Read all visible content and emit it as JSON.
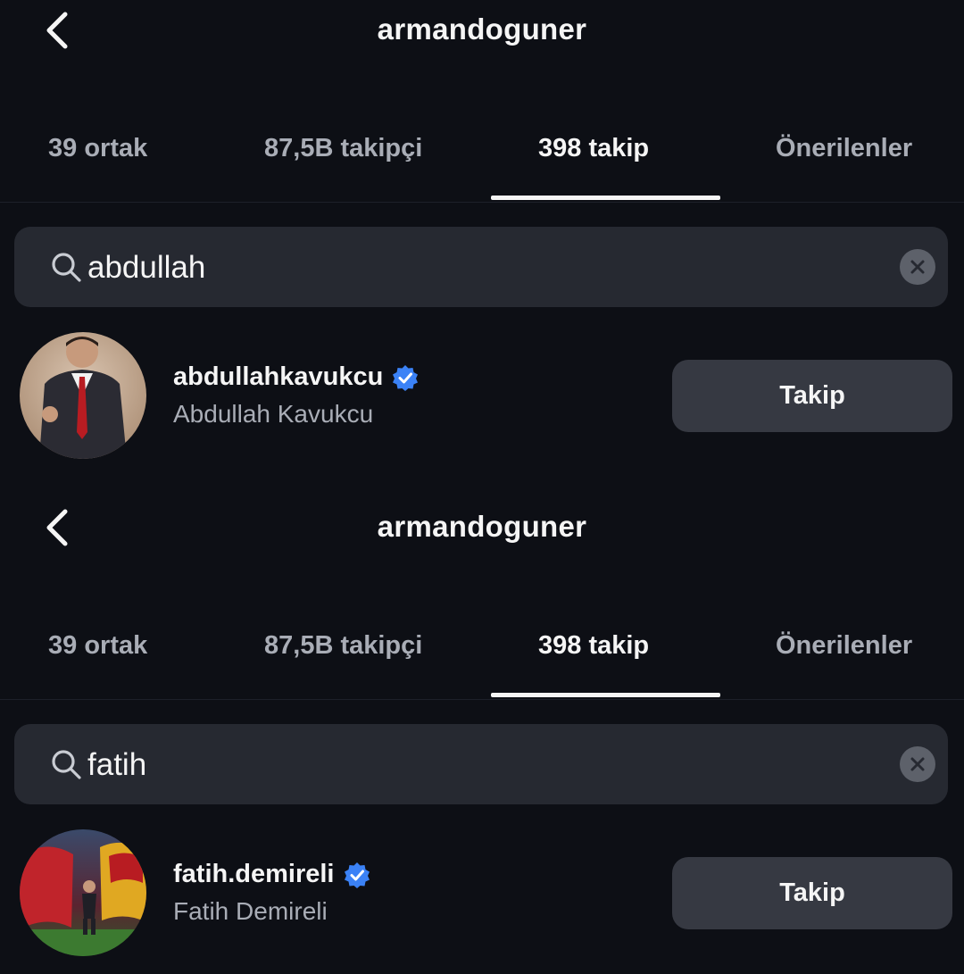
{
  "colors": {
    "background": "#0d0f15",
    "search_bg": "#262931",
    "button_bg": "#363942",
    "secondary_text": "#a9adb6",
    "verified_blue": "#3b82f6"
  },
  "screens": [
    {
      "header": {
        "back_icon": "chevron-left-icon",
        "title": "armandoguner"
      },
      "tabs": [
        {
          "label": "39 ortak",
          "active": false
        },
        {
          "label": "87,5B takipçi",
          "active": false
        },
        {
          "label": "398 takip",
          "active": true
        },
        {
          "label": "Önerilenler",
          "active": false
        }
      ],
      "search": {
        "icon": "search-icon",
        "value": "abdullah",
        "clear_icon": "clear-icon"
      },
      "result": {
        "username": "abdullahkavukcu",
        "verified": true,
        "full_name": "Abdullah Kavukcu",
        "button_label": "Takip"
      }
    },
    {
      "header": {
        "back_icon": "chevron-left-icon",
        "title": "armandoguner"
      },
      "tabs": [
        {
          "label": "39 ortak",
          "active": false
        },
        {
          "label": "87,5B takipçi",
          "active": false
        },
        {
          "label": "398 takip",
          "active": true
        },
        {
          "label": "Önerilenler",
          "active": false
        }
      ],
      "search": {
        "icon": "search-icon",
        "value": "fatih",
        "clear_icon": "clear-icon"
      },
      "result": {
        "username": "fatih.demireli",
        "verified": true,
        "full_name": "Fatih Demireli",
        "button_label": "Takip"
      }
    }
  ]
}
